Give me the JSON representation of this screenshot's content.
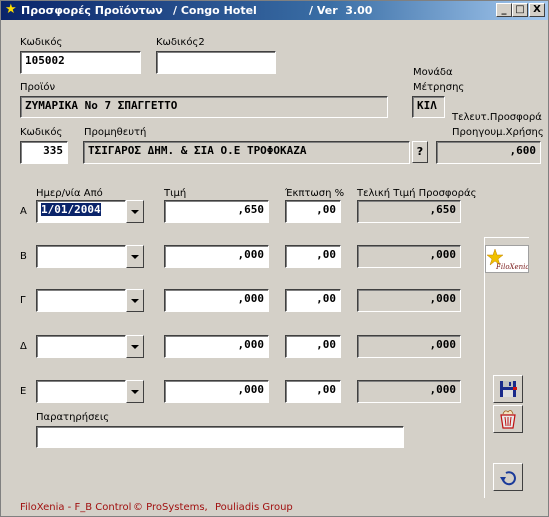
{
  "window": {
    "title_app": "Προσφορές Προϊόντων",
    "title_hotel": "/ Congo Hotel",
    "title_version": "/ Ver  3.00",
    "btn_min": "_",
    "btn_max": "□",
    "btn_close": "X"
  },
  "labels": {
    "code": "Κωδικός",
    "code2": "Κωδικός2",
    "product": "Προϊόν",
    "unit_line1": "Μονάδα",
    "unit_line2": "Μέτρησης",
    "supplier_code": "Κωδικός",
    "supplier": "Προμηθευτή",
    "last_offer_line1": "Τελευτ.Προσφορά",
    "last_offer_line2": "Προηγουμ.Χρήσης",
    "date_from": "Ημερ/νία Από",
    "price": "Τιμή",
    "discount": "Έκπτωση %",
    "final_price": "Τελική Τιμή Προσφοράς",
    "notes": "Παρατηρήσεις"
  },
  "form": {
    "code": "105002",
    "code2": "",
    "product": "ΖΥΜΑΡΙΚΑ Νο 7 ΣΠΑΓΓΕΤΤΟ",
    "unit": "ΚΙΛ",
    "supplier_code": "335",
    "supplier": "ΤΣΙΓΑΡΟΣ ΔΗΜ. & ΣΙΑ Ο.Ε ΤΡΟΦΟΚΑΖΑ",
    "supplier_lookup": "?",
    "last_offer": ",600",
    "notes": ""
  },
  "offers": [
    {
      "letter": "Α",
      "date": "1/01/2004",
      "price": ",650",
      "discount": ",00",
      "final": ",650"
    },
    {
      "letter": "Β",
      "date": "",
      "price": ",000",
      "discount": ",00",
      "final": ",000"
    },
    {
      "letter": "Γ",
      "date": "",
      "price": ",000",
      "discount": ",00",
      "final": ",000"
    },
    {
      "letter": "Δ",
      "date": "",
      "price": ",000",
      "discount": ",00",
      "final": ",000"
    },
    {
      "letter": "Ε",
      "date": "",
      "price": ",000",
      "discount": ",00",
      "final": ",000"
    }
  ],
  "side": {
    "logo_text": "FiloXenia"
  },
  "footer": {
    "left": "FiloXenia - F_B Control",
    "middle": "© ProSystems,",
    "right": "Pouliadis Group"
  },
  "colors": {
    "titlebar_start": "#0a246a",
    "window_bg": "#d4d0c8",
    "footer_text": "#a01010",
    "selection": "#0a246a"
  },
  "icons": [
    "app-star-icon",
    "save-disk-icon",
    "delete-basket-icon",
    "undo-arrow-icon",
    "filoxenia-logo"
  ]
}
